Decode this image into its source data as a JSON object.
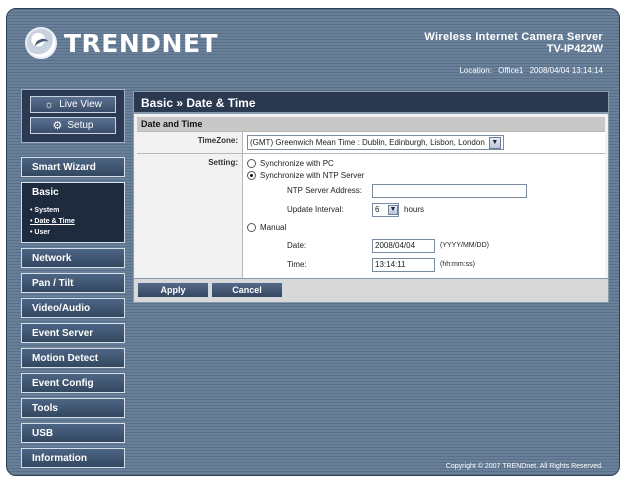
{
  "header": {
    "logo_text": "TRENDNET",
    "product_name": "Wireless Internet Camera Server",
    "product_model": "TV-IP422W",
    "location_label": "Location:",
    "location_value": "Office1",
    "datetime": "2008/04/04 13:14:14"
  },
  "sidebar": {
    "live_view": "Live View",
    "setup": "Setup",
    "menu": [
      {
        "label": "Smart Wizard"
      },
      {
        "label": "Basic"
      },
      {
        "label": "Network"
      },
      {
        "label": "Pan / Tilt"
      },
      {
        "label": "Video/Audio"
      },
      {
        "label": "Event Server"
      },
      {
        "label": "Motion Detect"
      },
      {
        "label": "Event Config"
      },
      {
        "label": "Tools"
      },
      {
        "label": "USB"
      },
      {
        "label": "Information"
      }
    ],
    "submenu": [
      "• System",
      "• Date & Time",
      "• User"
    ]
  },
  "page": {
    "title": "Basic » Date & Time",
    "section": "Date and Time",
    "timezone_label": "TimeZone:",
    "timezone_value": "(GMT) Greenwich Mean Time : Dublin, Edinburgh, Lisbon, London",
    "setting_label": "Setting:",
    "opt_sync_pc": "Synchronize with PC",
    "opt_sync_ntp": "Synchronize with NTP Server",
    "ntp_address_label": "NTP Server Address:",
    "ntp_address_value": "",
    "update_interval_label": "Update Interval:",
    "update_interval_value": "6",
    "update_interval_unit": "hours",
    "opt_manual": "Manual",
    "date_label": "Date:",
    "date_value": "2008/04/04",
    "date_hint": "(YYYY/MM/DD)",
    "time_label": "Time:",
    "time_value": "13:14:11",
    "time_hint": "(hh:mm:ss)"
  },
  "buttons": {
    "apply": "Apply",
    "cancel": "Cancel"
  },
  "footer": {
    "copyright": "Copyright © 2007 TRENDnet. All Rights Reserved."
  }
}
